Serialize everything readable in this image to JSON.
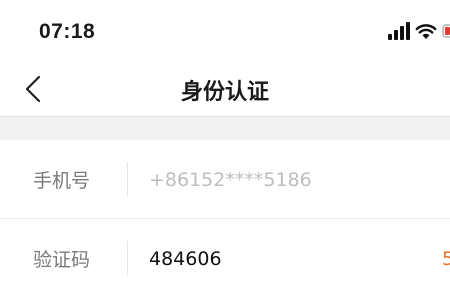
{
  "status_bar": {
    "time": "07:18",
    "icons": [
      "signal-icon",
      "wifi-icon",
      "battery-icon"
    ]
  },
  "nav": {
    "title": "身份认证",
    "back_icon": "chevron-left-icon"
  },
  "form": {
    "phone": {
      "label": "手机号",
      "value": "+86152****5186"
    },
    "code": {
      "label": "验证码",
      "value": "484606",
      "resend_partial": "5"
    }
  },
  "colors": {
    "accent": "#e8732a",
    "background_gap": "#f2f2f2"
  }
}
